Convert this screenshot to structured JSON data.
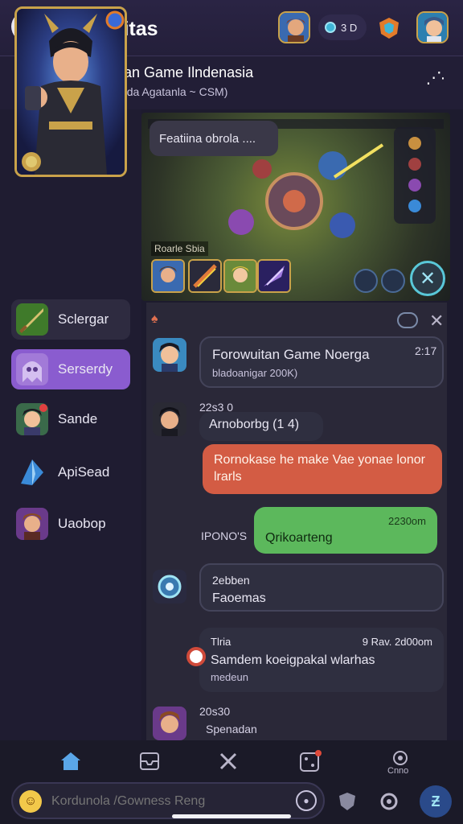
{
  "topbar": {
    "back_label": "K",
    "title": "Gomunitas",
    "coins": "3 D"
  },
  "community": {
    "name": "Komunitan Game Ilndenasia",
    "subtitle": "Ionor Cnda Agatanla ~ CSM)"
  },
  "sidebar": {
    "items": [
      {
        "label": "Sclergar",
        "icon": "sword-icon",
        "state": "dim"
      },
      {
        "label": "Serserdy",
        "icon": "ghost-icon",
        "state": "active"
      },
      {
        "label": "Sande",
        "icon": "hero-icon",
        "state": "normal"
      },
      {
        "label": "ApiSead",
        "icon": "crystal-icon",
        "state": "normal"
      },
      {
        "label": "Uaobop",
        "icon": "warrior-icon",
        "state": "normal"
      }
    ]
  },
  "game": {
    "bubble": "Featiina obrola ....",
    "label": "Roarle Sbia"
  },
  "chat": {
    "messages": [
      {
        "title": "Forowuitan Game Noerga",
        "time": "2:17",
        "sub": "bladoanigar 200K)"
      },
      {
        "time": "22s3 0",
        "text": "Arnoborbg (1 4)"
      },
      {
        "text": "Rornokase he make Vae yonae lonor lrarls"
      },
      {
        "time": "2230om",
        "prefix": "IPONO'S",
        "text": "Qrikoarteng"
      },
      {
        "time": "2ebben",
        "text": "Faoemas"
      },
      {
        "head": "Tlria",
        "time": "9 Rav. 2d00om",
        "text": "Samdem koeigpakal wlarhas",
        "sub": "medeun"
      },
      {
        "time": "20s30",
        "text": "Spenadan"
      }
    ]
  },
  "composer": {
    "placeholder": "Kordunola /Gowness Reng"
  },
  "nav": {
    "labels": [
      "Cnno"
    ]
  },
  "colors": {
    "accent": "#8a5ccf",
    "bubble_red": "#d35c44",
    "bubble_green": "#5cb85c",
    "gold": "#c9a24a"
  }
}
